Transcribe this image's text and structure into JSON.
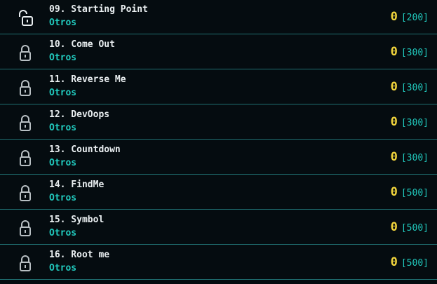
{
  "colors": {
    "background": "#050c10",
    "divider": "#1f6f71",
    "title": "#e9eef0",
    "category": "#21c9bd",
    "solved_count": "#f2d53c",
    "points": "#21c9bd",
    "lock_icon": "#b8bfc3"
  },
  "challenges": [
    {
      "title": "09. Starting Point",
      "category": "Otros",
      "solved": "0",
      "points": "[200]",
      "icon": "unlocked-padlock-icon"
    },
    {
      "title": "10. Come Out",
      "category": "Otros",
      "solved": "0",
      "points": "[300]",
      "icon": "locked-padlock-icon"
    },
    {
      "title": "11. Reverse Me",
      "category": "Otros",
      "solved": "0",
      "points": "[300]",
      "icon": "locked-padlock-icon"
    },
    {
      "title": "12. DevOops",
      "category": "Otros",
      "solved": "0",
      "points": "[300]",
      "icon": "locked-padlock-icon"
    },
    {
      "title": "13. Countdown",
      "category": "Otros",
      "solved": "0",
      "points": "[300]",
      "icon": "locked-padlock-icon"
    },
    {
      "title": "14. FindMe",
      "category": "Otros",
      "solved": "0",
      "points": "[500]",
      "icon": "locked-padlock-icon"
    },
    {
      "title": "15. Symbol",
      "category": "Otros",
      "solved": "0",
      "points": "[500]",
      "icon": "locked-padlock-icon"
    },
    {
      "title": "16. Root me",
      "category": "Otros",
      "solved": "0",
      "points": "[500]",
      "icon": "locked-padlock-icon"
    }
  ]
}
